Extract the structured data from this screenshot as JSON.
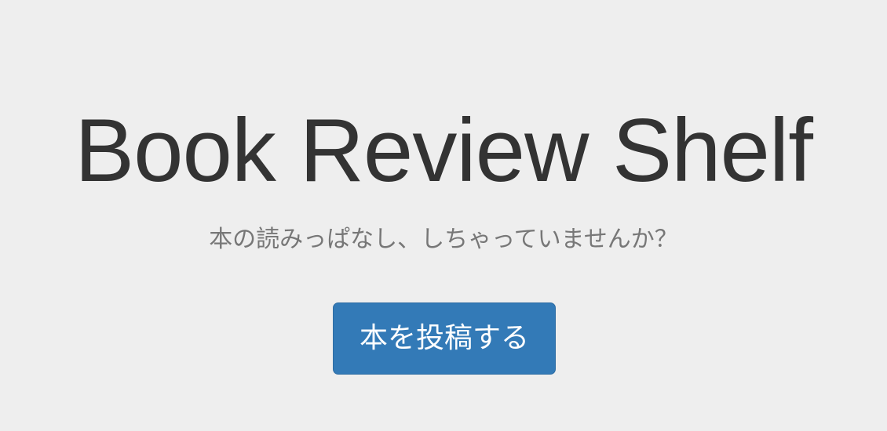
{
  "hero": {
    "title": "Book Review Shelf",
    "subtitle": "本の読みっぱなし、しちゃっていませんか？",
    "post_button_label": "本を投稿する"
  },
  "colors": {
    "background": "#eeeeee",
    "title": "#333333",
    "subtitle": "#777777",
    "button": "#337ab7"
  }
}
